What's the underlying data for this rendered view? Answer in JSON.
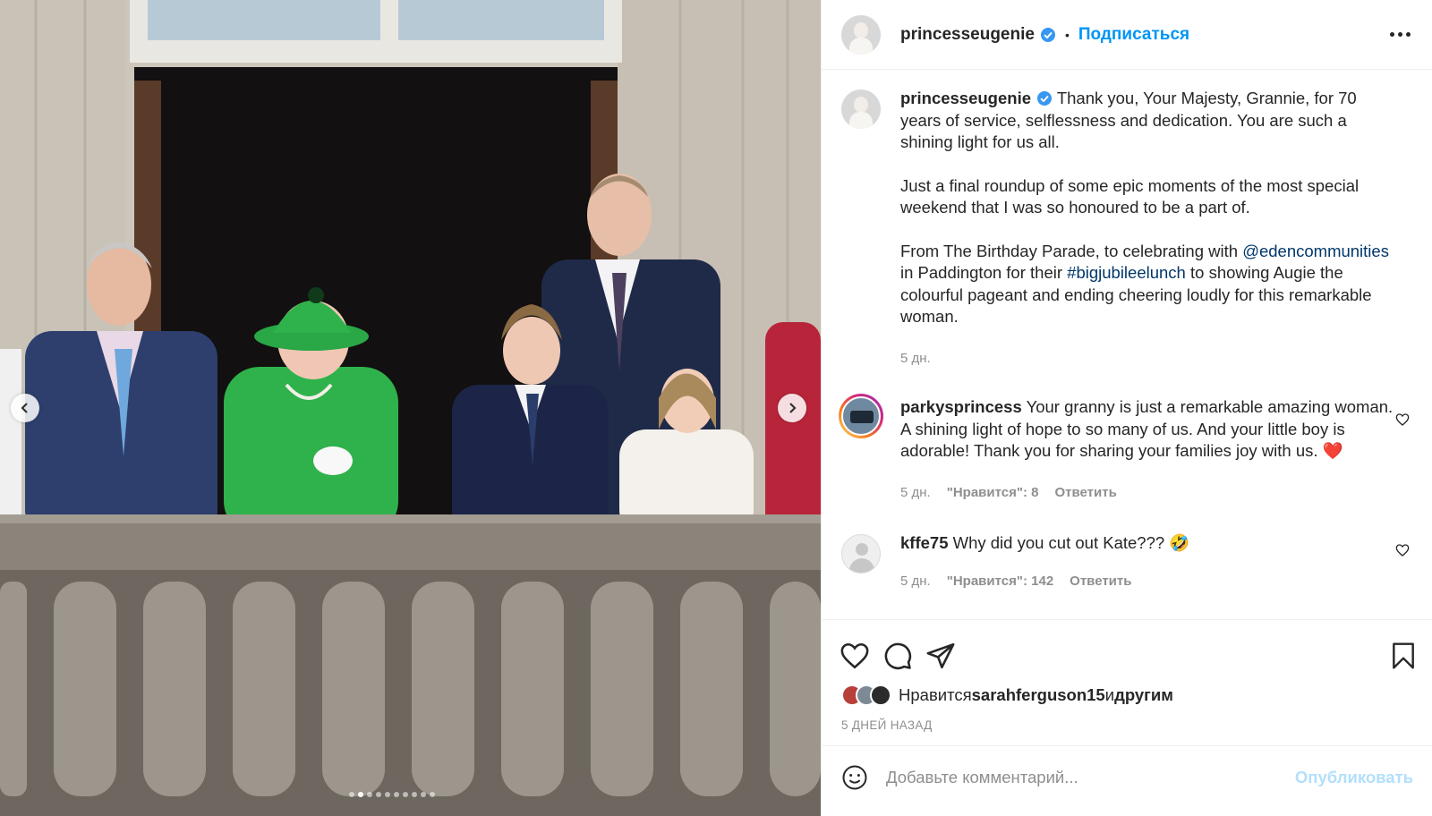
{
  "post": {
    "username": "princesseugenie",
    "follow_label": "Подписаться",
    "caption_user": "princesseugenie",
    "caption_p1": "Thank you, Your Majesty, Grannie, for 70 years of service, selflessness and dedication. You are such a shining light for us all.",
    "caption_p2": "Just a final roundup of some epic moments of the most special weekend that I was so honoured to be a part of.",
    "caption_p3_a": "From The Birthday Parade, to celebrating with ",
    "caption_p3_mention": "@edencommunities",
    "caption_p3_b": " in Paddington for their ",
    "caption_p3_tag": "#bigjubileelunch",
    "caption_p3_c": " to showing Augie the colourful pageant and ending cheering loudly for this remarkable woman.",
    "caption_time": "5 дн."
  },
  "comments": [
    {
      "username": "parkysprincess",
      "text": "Your granny is just a remarkable amazing woman. A shining light of hope to so many of us. And your little boy is adorable! Thank you for sharing your families joy with us. ❤️",
      "time": "5 дн.",
      "likes_label": "\"Нравится\": 8",
      "reply_label": "Ответить"
    },
    {
      "username": "kffe75",
      "text": "Why did you cut out Kate??? 🤣",
      "time": "5 дн.",
      "likes_label": "\"Нравится\": 142",
      "reply_label": "Ответить"
    }
  ],
  "footer": {
    "likes_prefix": "Нравится ",
    "likes_user": "sarahferguson15",
    "likes_and": " и ",
    "likes_others": "другим",
    "date": "5 ДНЕЙ НАЗАД",
    "comment_placeholder": "Добавьте комментарий...",
    "post_label": "Опубликовать"
  },
  "carousel": {
    "total_slides": 10,
    "active_slide": 2
  },
  "colors": {
    "accent": "#0095f6",
    "link": "#00376b",
    "muted": "#8e8e8e",
    "coat_green": "#2fb24c"
  },
  "icons": [
    "chevron-left-icon",
    "chevron-right-icon",
    "verified-badge-icon",
    "more-icon",
    "heart-icon",
    "comment-icon",
    "share-icon",
    "bookmark-icon",
    "emoji-icon"
  ]
}
